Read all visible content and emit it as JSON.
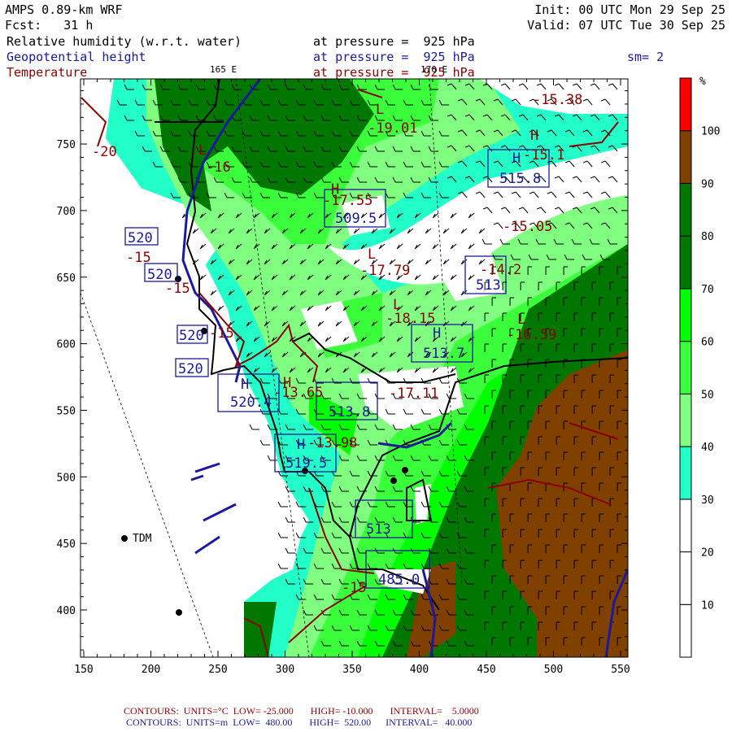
{
  "header": {
    "model": "AMPS 0.89-km WRF",
    "forecast": "Fcst:   31 h",
    "init": "Init: 00 UTC Mon 29 Sep 25",
    "valid": "Valid: 07 UTC Tue 30 Sep 25",
    "field1": {
      "name": "Relative humidity (w.r.t. water)",
      "level": "at pressure =  925 hPa"
    },
    "field2": {
      "name": "Geopotential height",
      "level": "at pressure =  925 hPa"
    },
    "field3": {
      "name": "Temperature",
      "level": "at pressure =  925 hPa"
    },
    "smoothing": "sm= 2",
    "lon_labels": [
      "165 E",
      "170 E"
    ]
  },
  "colorbar": {
    "unit": "%",
    "levels": [
      "10",
      "20",
      "30",
      "40",
      "50",
      "60",
      "70",
      "80",
      "90",
      "100"
    ],
    "colors": [
      "#ffffff",
      "#ffffff",
      "#ffffff",
      "#22ffc8",
      "#80ff80",
      "#3cff3c",
      "#00ff00",
      "#007800",
      "#007800",
      "#804000",
      "#ff0000"
    ]
  },
  "axes": {
    "x_ticks": [
      "150",
      "200",
      "250",
      "300",
      "350",
      "400",
      "450",
      "500",
      "550"
    ],
    "y_ticks": [
      "400",
      "450",
      "500",
      "550",
      "600",
      "650",
      "700",
      "750"
    ]
  },
  "map_labels": {
    "heights": [
      "520",
      "520",
      "520",
      "520",
      "520.4",
      "519.5",
      "513.8",
      "513.7",
      "509.5",
      "515.8",
      "513",
      "513",
      "485.0"
    ],
    "temps": [
      "-15.38",
      "-19.01",
      "-15.1",
      "-15.05",
      "-17.55",
      "-14.2",
      "-17.79",
      "-18.15",
      "-16.59",
      "-17.11",
      "-13.65",
      "-13.98",
      "-15",
      "-15",
      "-15",
      "-20",
      "-16",
      "-15"
    ],
    "highs": "H",
    "lows": "L",
    "station": "TDM"
  },
  "footer": {
    "temp_contours": {
      "label": "CONTOURS:",
      "units": "UNITS=°C",
      "low": "LOW= -25.000",
      "high": "HIGH= -10.000",
      "interval": "INTERVAL=    5.0000"
    },
    "height_contours": {
      "label": "CONTOURS:",
      "units": "UNITS=m",
      "low": "LOW=  480.00",
      "high": "HIGH=  520.00",
      "interval": "INTERVAL=   40.000"
    }
  }
}
